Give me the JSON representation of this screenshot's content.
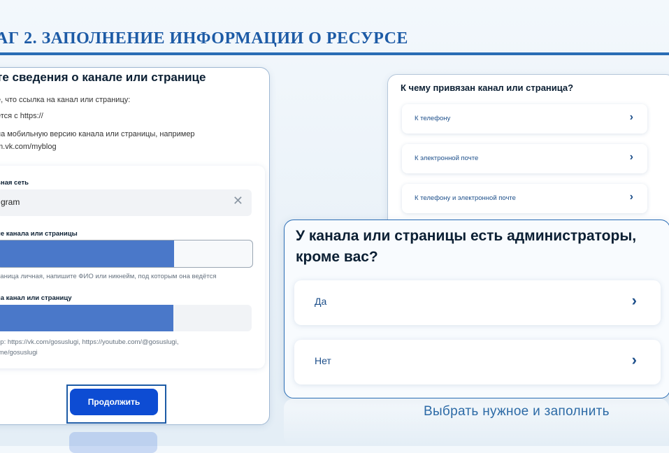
{
  "header": {
    "title": "АГ 2. ЗАПОЛНЕНИЕ ИНФОРМАЦИИ О РЕСУРСЕ"
  },
  "form": {
    "heading": "те сведения о канале или странице",
    "intro": "е, что ссылка на канал или страницу:",
    "rule1": "ется с https://",
    "rule2a": "на мобильную версию канала или страницы, например",
    "rule2b": "m.vk.com/myblog",
    "network_label": "ьная сеть",
    "network_value": "gram",
    "name_label": "ие канала или страницы",
    "name_hint": "раница личная, напишите ФИО или никнейм, под которым она ведётся",
    "link_label": "на канал или страницу",
    "link_hint_1": "ер: https://vk.com/gosuslugi, https://youtube.com/@gosuslugi,",
    "link_hint_2": ".me/gosuslugi",
    "continue_label": "Продолжить",
    "clear_icon": "close-icon"
  },
  "binding": {
    "question": "К чему привязан канал или страница?",
    "options": [
      {
        "label": "К телефону"
      },
      {
        "label": "К электронной почте"
      },
      {
        "label": "К телефону и электронной почте"
      }
    ]
  },
  "admins": {
    "question": "У канала или страницы есть администраторы, кроме вас?",
    "options": [
      {
        "label": "Да"
      },
      {
        "label": "Нет"
      }
    ]
  },
  "caption": "Выбрать нужное и заполнить",
  "colors": {
    "accent": "#0d4cd3",
    "header": "#1d5ba6",
    "redaction": "#4a78c9"
  }
}
